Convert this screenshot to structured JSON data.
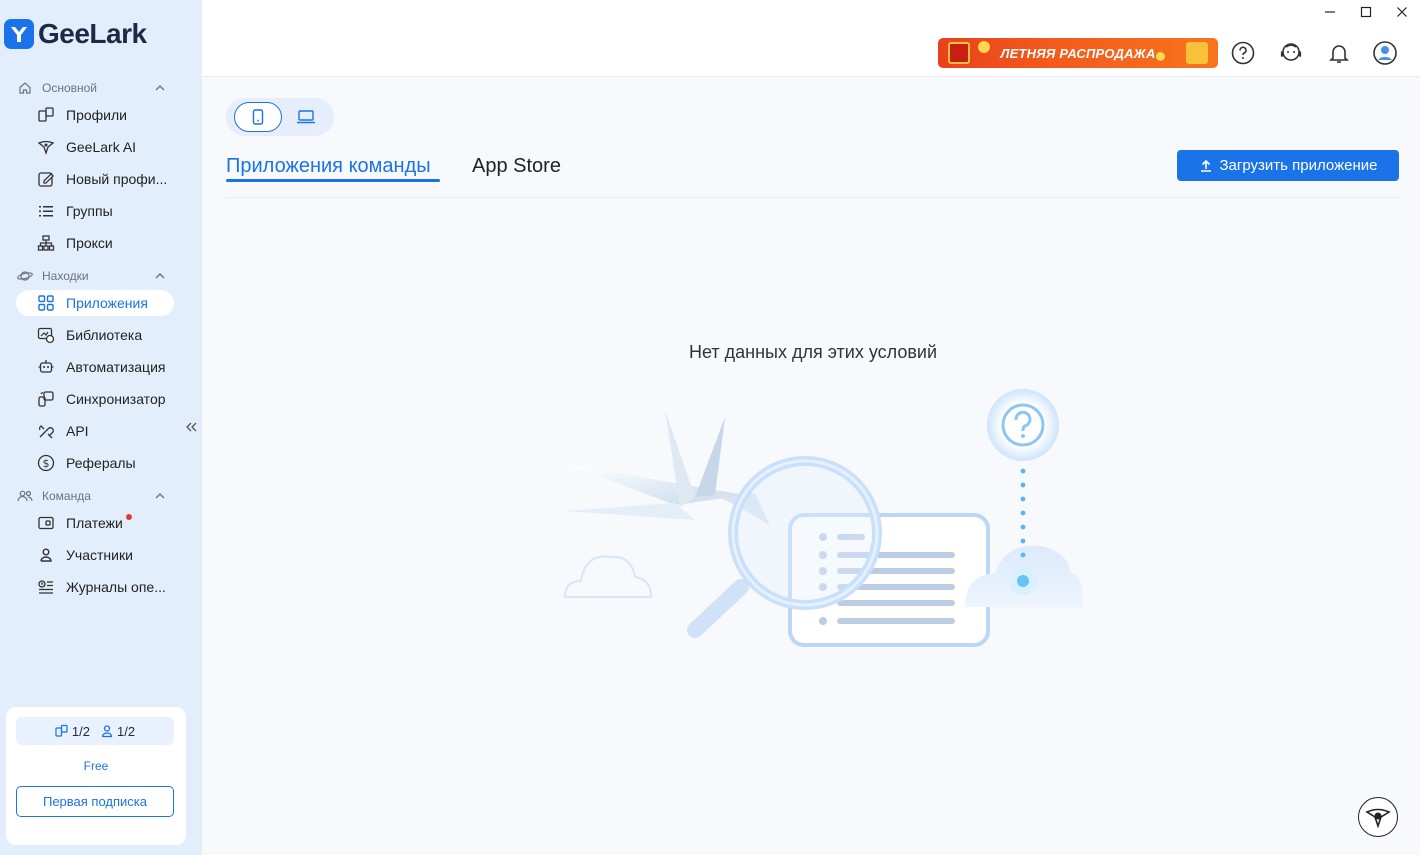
{
  "app": {
    "name": "GeeLark"
  },
  "sidebar": {
    "sections": [
      {
        "title": "Основной",
        "icon": "home-icon"
      },
      {
        "title": "Находки",
        "icon": "planet-icon"
      },
      {
        "title": "Команда",
        "icon": "team-icon"
      }
    ],
    "items": [
      {
        "label": "Профили",
        "icon": "profiles-icon"
      },
      {
        "label": "GeeLark AI",
        "icon": "ai-icon"
      },
      {
        "label": "Новый профи...",
        "icon": "edit-icon"
      },
      {
        "label": "Группы",
        "icon": "list-icon"
      },
      {
        "label": "Прокси",
        "icon": "proxy-icon"
      },
      {
        "label": "Приложения",
        "icon": "apps-icon",
        "active": true
      },
      {
        "label": "Библиотека",
        "icon": "library-icon"
      },
      {
        "label": "Автоматизация",
        "icon": "robot-icon"
      },
      {
        "label": "Синхронизатор",
        "icon": "sync-icon"
      },
      {
        "label": "API",
        "icon": "api-icon"
      },
      {
        "label": "Рефералы",
        "icon": "dollar-icon"
      },
      {
        "label": "Платежи",
        "icon": "wallet-icon",
        "badge": "red-dot"
      },
      {
        "label": "Участники",
        "icon": "user-icon"
      },
      {
        "label": "Журналы опе...",
        "icon": "logs-icon"
      }
    ],
    "plan": {
      "profiles_usage": "1/2",
      "members_usage": "1/2",
      "name": "Free",
      "cta": "Первая подписка"
    }
  },
  "header": {
    "promo_text": "ЛЕТНЯЯ РАСПРОДАЖА",
    "icons": [
      "help-icon",
      "support-icon",
      "bell-icon",
      "account-icon"
    ]
  },
  "main": {
    "device_toggle": [
      "phone-icon",
      "laptop-icon"
    ],
    "tabs": [
      {
        "label": "Приложения команды",
        "active": true
      },
      {
        "label": "App Store",
        "active": false
      }
    ],
    "upload_button": "Загрузить приложение",
    "empty_message": "Нет данных для этих условий"
  },
  "colors": {
    "accent": "#1a73e8",
    "sidebar_bg": "#e3eefc",
    "promo": "#f35a1c",
    "badge": "#e53935"
  }
}
